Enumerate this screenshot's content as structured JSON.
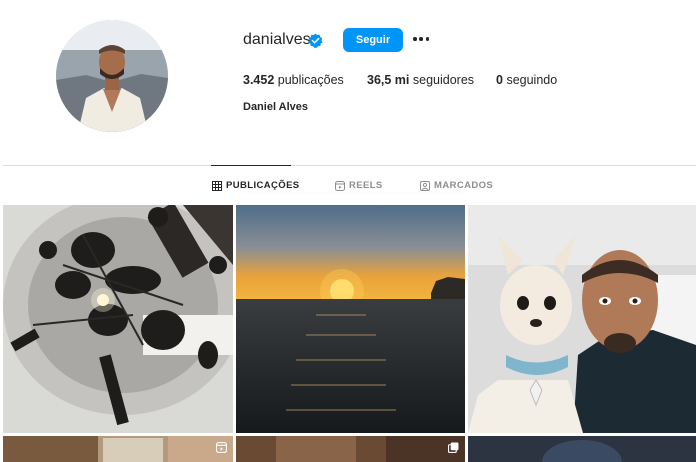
{
  "profile": {
    "username": "danialves",
    "follow_label": "Seguir",
    "stats": {
      "posts_count": "3.452",
      "posts_label": "publicações",
      "followers_count": "36,5 mi",
      "followers_label": "seguidores",
      "following_count": "0",
      "following_label": "seguindo"
    },
    "full_name": "Daniel Alves"
  },
  "tabs": [
    {
      "label": "PUBLICAÇÕES",
      "icon": "grid-icon",
      "active": true
    },
    {
      "label": "REELS",
      "icon": "reels-icon",
      "active": false
    },
    {
      "label": "MARCADOS",
      "icon": "tagged-icon",
      "active": false
    }
  ],
  "posts": [
    {
      "kind": "photo",
      "subject": "drum-kit-sculpture"
    },
    {
      "kind": "photo",
      "subject": "sunset-over-sea"
    },
    {
      "kind": "photo",
      "subject": "selfie-with-chihuahua"
    },
    {
      "kind": "reel",
      "subject": "interior"
    },
    {
      "kind": "carousel",
      "subject": "interior"
    },
    {
      "kind": "photo",
      "subject": "portrait"
    }
  ],
  "colors": {
    "accent": "#0095f6",
    "verified": "#0095f6",
    "divider": "#dbdbdb",
    "muted": "#8e8e8e"
  }
}
